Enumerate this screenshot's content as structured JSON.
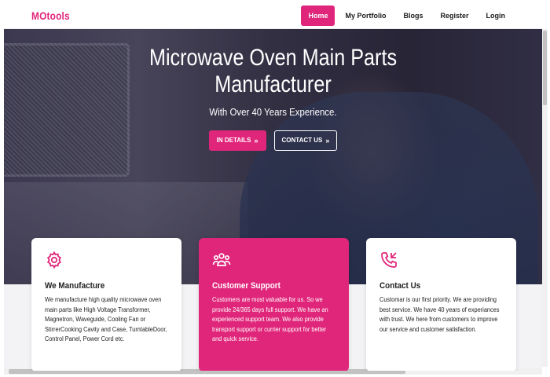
{
  "brand": "MOtools",
  "nav": {
    "items": [
      "Home",
      "My Portfolio",
      "Blogs",
      "Register",
      "Login"
    ]
  },
  "hero": {
    "title_line1": "Microwave Oven Main Parts",
    "title_line2": "Manufacturer",
    "subtitle": "With Over 40 Years Experience.",
    "btn_details": "IN DETAILS",
    "btn_contact": "CONTACT US"
  },
  "cards": [
    {
      "icon": "gear-icon",
      "title": "We Manufacture",
      "text": "We manufacture high quality microwave oven main parts like High Voltage Transformer, Magnetron, Waveguide, Cooling Fan or StirrerCooking Cavity and Case, TurntableDoor, Control Panel, Power Cord etc."
    },
    {
      "icon": "users-icon",
      "title": "Customer Support",
      "text": "Customers are most valuable for us. So we provide 24/365 days full support. We have an experienced support team. We also provide transport support or currier support for better and quick service."
    },
    {
      "icon": "phone-icon",
      "title": "Contact Us",
      "text": "Customar is our first priority. We are providing best service. We have 40 years of experiances with trust. We here from customers to improve our service and customer satisfaction."
    }
  ],
  "colors": {
    "accent": "#e0267b"
  }
}
